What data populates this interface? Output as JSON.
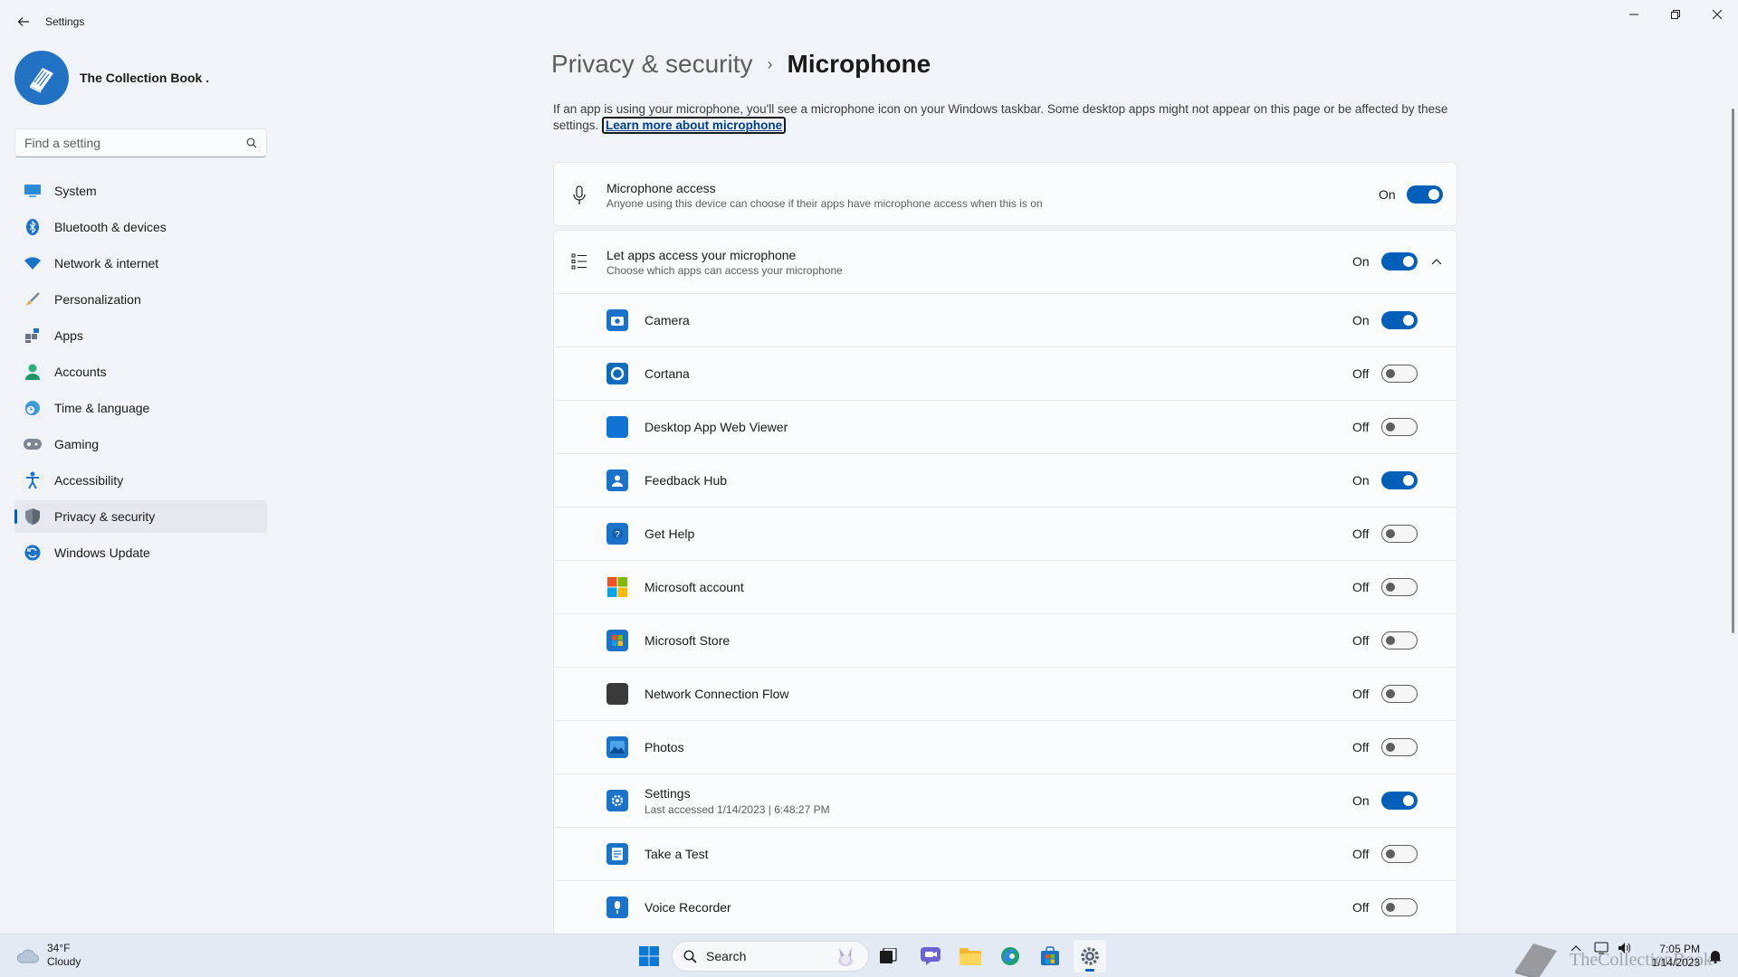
{
  "window": {
    "title": "Settings"
  },
  "profile": {
    "name": "The Collection Book ."
  },
  "search": {
    "placeholder": "Find a setting"
  },
  "sidebar": {
    "items": [
      {
        "label": "System",
        "icon": "system-icon",
        "active": false
      },
      {
        "label": "Bluetooth & devices",
        "icon": "bluetooth-icon",
        "active": false
      },
      {
        "label": "Network & internet",
        "icon": "wifi-icon",
        "active": false
      },
      {
        "label": "Personalization",
        "icon": "brush-icon",
        "active": false
      },
      {
        "label": "Apps",
        "icon": "apps-icon",
        "active": false
      },
      {
        "label": "Accounts",
        "icon": "person-icon",
        "active": false
      },
      {
        "label": "Time & language",
        "icon": "globe-clock-icon",
        "active": false
      },
      {
        "label": "Gaming",
        "icon": "gamepad-icon",
        "active": false
      },
      {
        "label": "Accessibility",
        "icon": "accessibility-icon",
        "active": false
      },
      {
        "label": "Privacy & security",
        "icon": "shield-icon",
        "active": true
      },
      {
        "label": "Windows Update",
        "icon": "update-icon",
        "active": false
      }
    ]
  },
  "breadcrumb": {
    "parent": "Privacy & security",
    "separator": "›",
    "current": "Microphone"
  },
  "description": {
    "text": "If an app is using your microphone, you'll see a microphone icon on your Windows taskbar. Some desktop apps might not appear on this page or be affected by these settings.",
    "link": "Learn more about microphone"
  },
  "microphone_access": {
    "title": "Microphone access",
    "subtitle": "Anyone using this device can choose if their apps have microphone access when this is on",
    "state": "On"
  },
  "let_apps": {
    "title": "Let apps access your microphone",
    "subtitle": "Choose which apps can access your microphone",
    "state": "On"
  },
  "apps": [
    {
      "name": "Camera",
      "state": "On",
      "sub": "",
      "icon": "camera-icon",
      "color": "#1a73c9"
    },
    {
      "name": "Cortana",
      "state": "Off",
      "sub": "",
      "icon": "cortana-icon",
      "color": "#0f6cbd"
    },
    {
      "name": "Desktop App Web Viewer",
      "state": "Off",
      "sub": "",
      "icon": "web-viewer-icon",
      "color": "#1173d4"
    },
    {
      "name": "Feedback Hub",
      "state": "On",
      "sub": "",
      "icon": "feedback-hub-icon",
      "color": "#1a73c9"
    },
    {
      "name": "Get Help",
      "state": "Off",
      "sub": "",
      "icon": "get-help-icon",
      "color": "#1a73c9"
    },
    {
      "name": "Microsoft account",
      "state": "Off",
      "sub": "",
      "icon": "microsoft-logo-icon",
      "color": "#f25022"
    },
    {
      "name": "Microsoft Store",
      "state": "Off",
      "sub": "",
      "icon": "store-icon",
      "color": "#1a73c9"
    },
    {
      "name": "Network Connection Flow",
      "state": "Off",
      "sub": "",
      "icon": "network-flow-icon",
      "color": "#3a3a3a"
    },
    {
      "name": "Photos",
      "state": "Off",
      "sub": "",
      "icon": "photos-icon",
      "color": "#1a73c9"
    },
    {
      "name": "Settings",
      "state": "On",
      "sub": "Last accessed 1/14/2023  |  6:48:27 PM",
      "icon": "settings-gear-icon",
      "color": "#1a73c9"
    },
    {
      "name": "Take a Test",
      "state": "Off",
      "sub": "",
      "icon": "take-a-test-icon",
      "color": "#1a73c9"
    },
    {
      "name": "Voice Recorder",
      "state": "Off",
      "sub": "",
      "icon": "voice-recorder-icon",
      "color": "#1a73c9"
    }
  ],
  "taskbar": {
    "weather_temp": "34°F",
    "weather_desc": "Cloudy",
    "search_label": "Search",
    "time": "7:05 PM",
    "date": "1/14/2023",
    "watermark": "TheCollectionBook"
  },
  "colors": {
    "accent": "#005fb8",
    "background": "#f0f4f9",
    "card": "#fbfcfd"
  }
}
